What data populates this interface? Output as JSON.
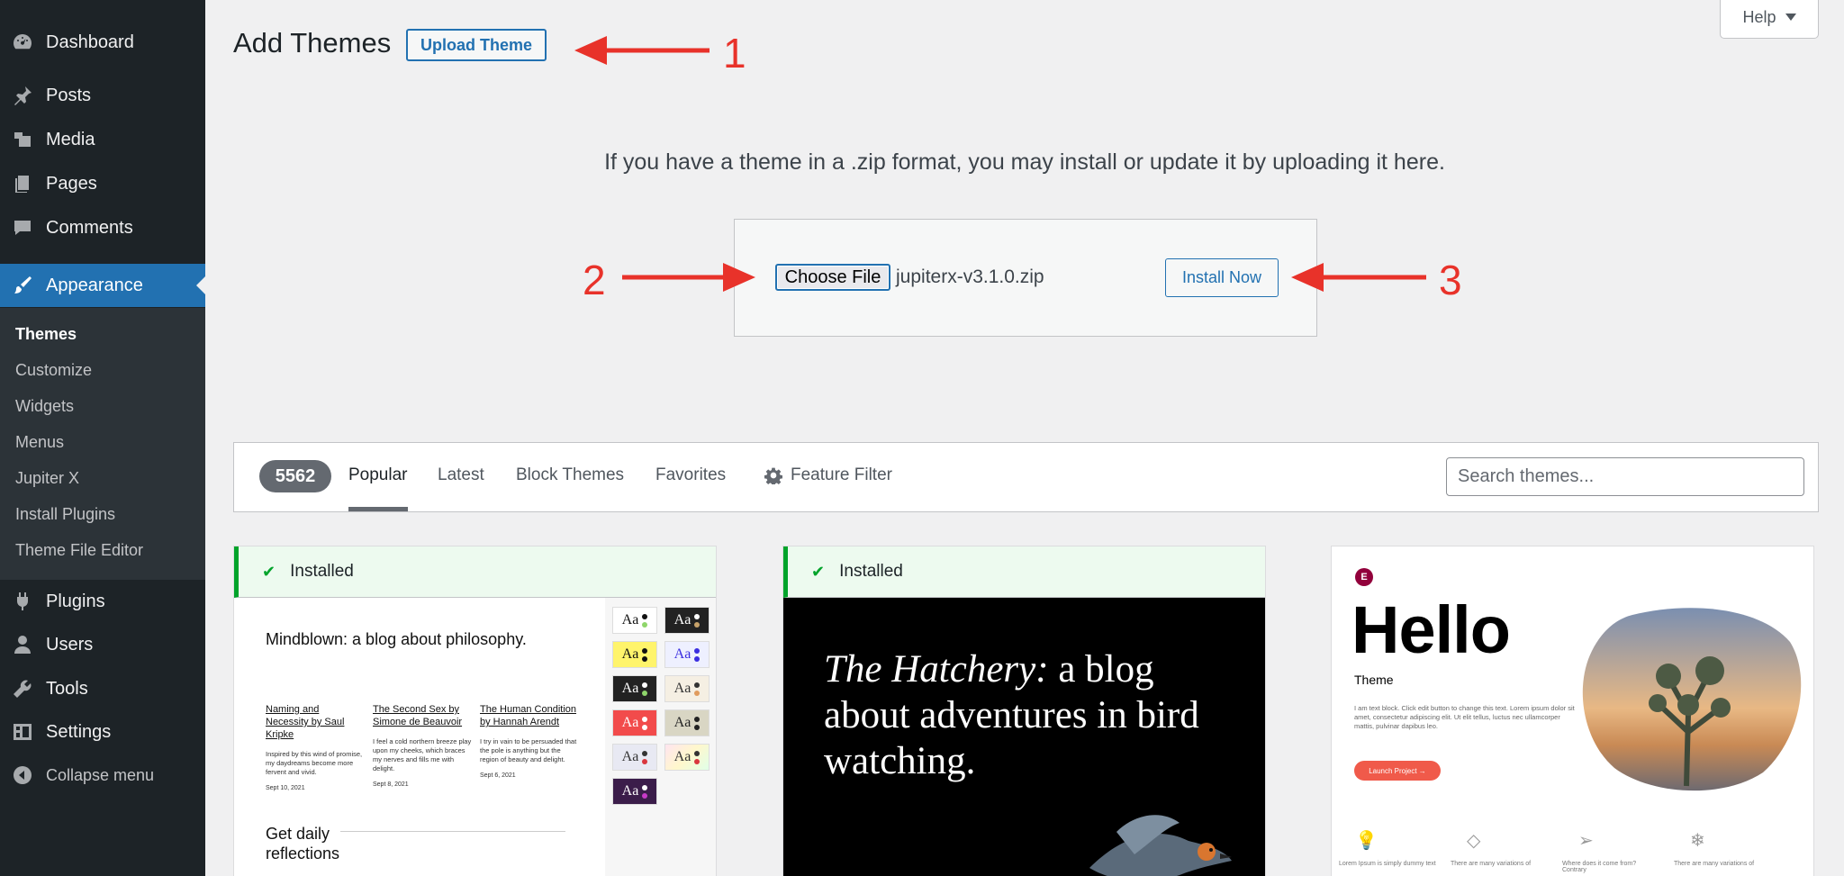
{
  "sidebar": {
    "items": [
      {
        "label": "Dashboard",
        "icon": "dashboard-icon"
      },
      {
        "label": "Posts",
        "icon": "pin-icon"
      },
      {
        "label": "Media",
        "icon": "media-icon"
      },
      {
        "label": "Pages",
        "icon": "pages-icon"
      },
      {
        "label": "Comments",
        "icon": "comment-icon"
      },
      {
        "label": "Appearance",
        "icon": "brush-icon"
      },
      {
        "label": "Plugins",
        "icon": "plug-icon"
      },
      {
        "label": "Users",
        "icon": "user-icon"
      },
      {
        "label": "Tools",
        "icon": "wrench-icon"
      },
      {
        "label": "Settings",
        "icon": "settings-icon"
      },
      {
        "label": "Collapse menu",
        "icon": "collapse-icon"
      }
    ],
    "submenu": [
      "Themes",
      "Customize",
      "Widgets",
      "Menus",
      "Jupiter X",
      "Install Plugins",
      "Theme File Editor"
    ]
  },
  "header": {
    "title": "Add Themes",
    "upload_label": "Upload Theme",
    "help_label": "Help"
  },
  "annotations": [
    "1",
    "2",
    "3"
  ],
  "upload": {
    "help_text": "If you have a theme in a .zip format, you may install or update it by uploading it here.",
    "choose_label": "Choose File",
    "file_name": "jupiterx-v3.1.0.zip",
    "install_label": "Install Now"
  },
  "filter": {
    "count": "5562",
    "tabs": [
      "Popular",
      "Latest",
      "Block Themes",
      "Favorites"
    ],
    "feature_filter": "Feature Filter",
    "search_placeholder": "Search themes..."
  },
  "cards": {
    "installed_label": "Installed",
    "tt1": {
      "blogname": "Mindblown: a blog about philosophy.",
      "posts": [
        {
          "title": "Naming and Necessity by Saul Kripke",
          "excerpt": "Inspired by this wind of promise, my daydreams become more fervent and vivid.",
          "date": "Sept 10, 2021"
        },
        {
          "title": "The Second Sex by Simone de Beauvoir",
          "excerpt": "I feel a cold northern breeze play upon my cheeks, which braces my nerves and fills me with delight.",
          "date": "Sept 8, 2021"
        },
        {
          "title": "The Human Condition by Hannah Arendt",
          "excerpt": "I try in vain to be persuaded that the pole is anything but the region of beauty and delight.",
          "date": "Sept 6, 2021"
        }
      ],
      "daily": "Get daily reflections",
      "swatch_label": "Aa"
    },
    "hatchery": {
      "italic": "The Hatchery:",
      "rest": " a blog about adventures in bird watching."
    },
    "hello": {
      "logo": "E",
      "title": "Hello",
      "subtitle": "Theme",
      "lorem": "I am text block. Click edit button to change this text. Lorem ipsum dolor sit amet, consectetur adipiscing elit. Ut elit tellus, luctus nec ullamcorper mattis, pulvinar dapibus leo.",
      "launch": "Launch Project  →",
      "features": [
        "Lorem Ipsum is simply dummy text",
        "There are many variations of",
        "Where does it come from? Contrary",
        "There are many variations of"
      ]
    }
  },
  "colors": {
    "accent": "#2271b1",
    "sidebar_bg": "#1d2327",
    "annotation": "#e8322a",
    "installed": "#00a32a"
  }
}
